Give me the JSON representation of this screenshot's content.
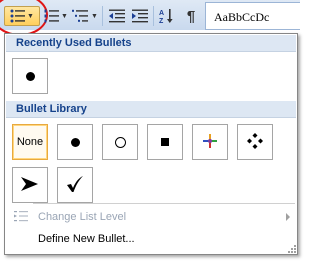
{
  "ribbon": {
    "style_preview": "AaBbCcDc",
    "buttons": [
      {
        "name": "bullets-button",
        "icon": "bullet-list-icon"
      },
      {
        "name": "numbering-button",
        "icon": "numbered-list-icon"
      },
      {
        "name": "multilevel-list-button",
        "icon": "multilevel-list-icon"
      },
      {
        "name": "decrease-indent-button",
        "icon": "decrease-indent-icon"
      },
      {
        "name": "increase-indent-button",
        "icon": "increase-indent-icon"
      },
      {
        "name": "sort-button",
        "icon": "sort-az-icon"
      },
      {
        "name": "show-formatting-button",
        "icon": "pilcrow-icon"
      }
    ],
    "pilcrow": "¶",
    "sort_a": "A",
    "sort_z": "Z"
  },
  "dropdown": {
    "recent_header": "Recently Used Bullets",
    "library_header": "Bullet Library",
    "none_label": "None",
    "recent_bullets": [
      "filled-circle-bullet"
    ],
    "library_bullets": [
      "none",
      "filled-circle-bullet",
      "hollow-circle-bullet",
      "filled-square-bullet",
      "color-star-bullet",
      "diamond-cluster-bullet",
      "arrowhead-bullet",
      "checkmark-bullet"
    ],
    "change_list_level": "Change List Level",
    "define_new_bullet": "Define New Bullet...",
    "accent_color": "#15428b",
    "selected_border_color": "#e8a93f",
    "highlight_circle_color": "#e01515"
  }
}
